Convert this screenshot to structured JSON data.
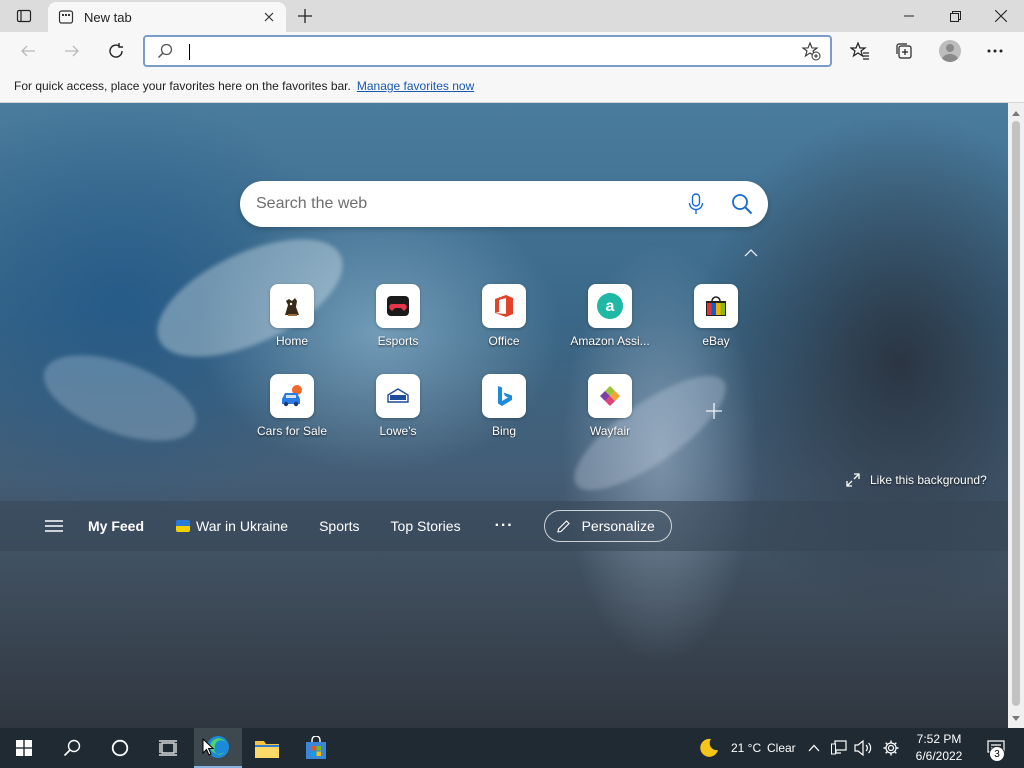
{
  "browser": {
    "tab_title": "New tab",
    "address_value": "",
    "favorites_bar": {
      "message": "For quick access, place your favorites here on the favorites bar.",
      "link": "Manage favorites now"
    }
  },
  "newtab": {
    "search_placeholder": "Search the web",
    "top_sites": [
      {
        "label": "Home",
        "icon": "home-site-icon"
      },
      {
        "label": "Esports",
        "icon": "esports-site-icon"
      },
      {
        "label": "Office",
        "icon": "office-site-icon"
      },
      {
        "label": "Amazon Assi...",
        "icon": "amazon-assistant-site-icon"
      },
      {
        "label": "eBay",
        "icon": "ebay-site-icon"
      },
      {
        "label": "Cars for Sale",
        "icon": "cars-site-icon"
      },
      {
        "label": "Lowe's",
        "icon": "lowes-site-icon"
      },
      {
        "label": "Bing",
        "icon": "bing-site-icon"
      },
      {
        "label": "Wayfair",
        "icon": "wayfair-site-icon"
      }
    ],
    "like_background": "Like this background?",
    "feed": {
      "items": [
        "My Feed",
        "War in Ukraine",
        "Sports",
        "Top Stories"
      ],
      "more": "···",
      "personalize": "Personalize"
    }
  },
  "taskbar": {
    "weather_temp": "21 °C",
    "weather_desc": "Clear",
    "time": "7:52 PM",
    "date": "6/6/2022",
    "notification_count": "3"
  },
  "colors": {
    "accent": "#7a9cc6",
    "link": "#1a57b0",
    "taskbar": "#1f2a33"
  }
}
